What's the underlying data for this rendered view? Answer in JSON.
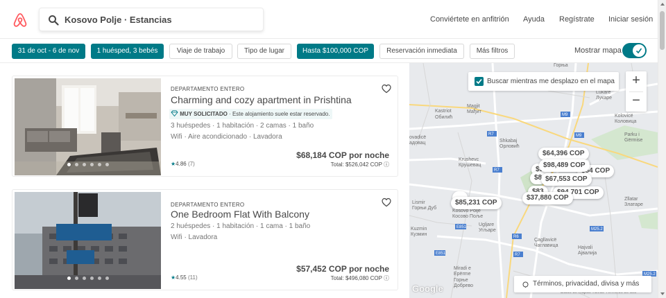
{
  "header": {
    "search_text": "Kosovo Polje · Estancias",
    "nav": [
      "Conviértete en anfitrión",
      "Ayuda",
      "Regístrate",
      "Iniciar sesión"
    ]
  },
  "filters": {
    "pills": [
      {
        "label": "31 de oct - 6 de nov",
        "active": true
      },
      {
        "label": "1 huésped, 3 bebés",
        "active": true
      },
      {
        "label": "Viaje de trabajo",
        "active": false
      },
      {
        "label": "Tipo de lugar",
        "active": false
      },
      {
        "label": "Hasta $100,000 COP",
        "active": true
      },
      {
        "label": "Reservación inmediata",
        "active": false
      },
      {
        "label": "Más filtros",
        "active": false
      }
    ],
    "show_map_label": "Mostrar mapa",
    "show_map_on": true
  },
  "listings": [
    {
      "type": "DEPARTAMENTO ENTERO",
      "title": "Charming and cozy apartment in Prishtina",
      "badge_strong": "MUY SOLICITADO",
      "badge_text": " · Este alojamiento suele estar reservado.",
      "details": "3 huéspedes · 1 habitación · 2 camas · 1 baño",
      "amenities": "Wifi · Aire acondicionado · Lavadora",
      "price": "$68,184 COP por noche",
      "total": "Total: $526,042 COP",
      "rating": "4.86",
      "reviews": "(7)"
    },
    {
      "type": "DEPARTAMENTO ENTERO",
      "title": "One Bedroom Flat With Balcony",
      "details": "2 huéspedes · 1 habitación · 1 cama · 1 baño",
      "amenities": "Wifi · Lavadora",
      "price": "$57,452 COP por noche",
      "total": "Total: $496,080 COP",
      "rating": "4.55",
      "reviews": "(11)"
    }
  ],
  "map": {
    "search_as_move": "Buscar mientras me desplazo en el mapa",
    "terms": "Términos, privacidad, divisa y más",
    "google": "Google",
    "footer": "Datos de mapas ©2019  Términos de uso",
    "zoom_in": "+",
    "zoom_out": "−",
    "pins": [
      "$64,396 COP",
      "$91",
      "$98,489 COP",
      "$84 COP",
      "$67,553 COP",
      "$8",
      "$83",
      "$94,701 COP",
      "$37,880 COP",
      "$85,231 COP"
    ],
    "places": [
      "Kastriot",
      "Обилић",
      "Magjit",
      "Мађит",
      "Lukare",
      "Лукаре",
      "Kolovicë",
      "Коловица",
      "Shkabaj",
      "Орловић",
      "Krushevc",
      "Крушевац",
      "Parku i",
      "Gërmise",
      "Lismir",
      "Горњи Дуб",
      "Kosovo Polje",
      "Косово Поље",
      "Ugljare",
      "Угљаре",
      "Kuzmin",
      "Кузмин",
      "Çagllavicë",
      "Чаглавица",
      "Hajvali",
      "Ајвалија",
      "Miradi e",
      "Epërme",
      "Горње",
      "Добрево",
      "Zllatar",
      "Златаре",
      "Горња"
    ]
  }
}
